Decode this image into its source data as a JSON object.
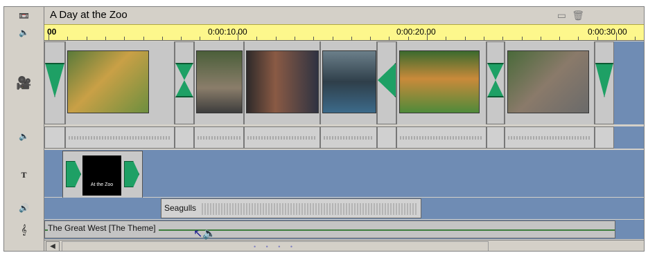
{
  "project": {
    "title": "A Day at the Zoo"
  },
  "toolbar": {
    "icons": [
      "camcorder-icon",
      "screen-icon",
      "trash-icon"
    ]
  },
  "ruler": {
    "labels": [
      "00",
      "0:00:10.00",
      "0:00:20.00",
      "0:00:30.00"
    ]
  },
  "left_icons": [
    "camcorder-icon",
    "speaker-icon",
    "camera-icon",
    "speaker-small-icon",
    "title-text-icon",
    "sound-effect-icon",
    "music-note-icon"
  ],
  "title_clip": {
    "text": "At the Zoo"
  },
  "sound_clip": {
    "label": "Seagulls"
  },
  "music_clip": {
    "label": "The Great West [The Theme]"
  },
  "scroll": {
    "dots": "• • • •"
  },
  "colors": {
    "ruler": "#fdf78c",
    "track": "#6f8cb4",
    "transition": "#1ea065",
    "clip": "#c7c7c7"
  }
}
